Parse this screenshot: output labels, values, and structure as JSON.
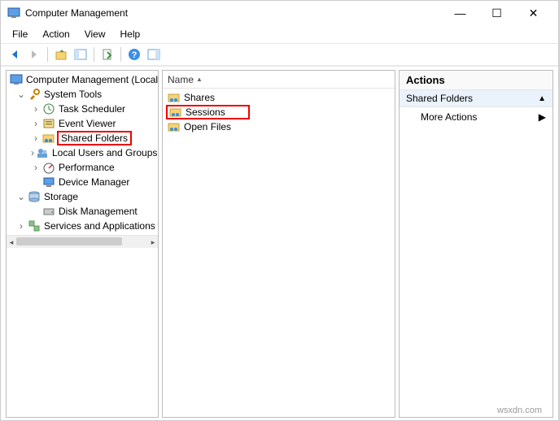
{
  "window": {
    "title": "Computer Management",
    "controls": {
      "min": "—",
      "max": "☐",
      "close": "✕"
    }
  },
  "menubar": {
    "file": "File",
    "action": "Action",
    "view": "View",
    "help": "Help"
  },
  "tree": {
    "root": "Computer Management (Local)",
    "system_tools": "System Tools",
    "task_scheduler": "Task Scheduler",
    "event_viewer": "Event Viewer",
    "shared_folders": "Shared Folders",
    "local_users": "Local Users and Groups",
    "performance": "Performance",
    "device_manager": "Device Manager",
    "storage": "Storage",
    "disk_management": "Disk Management",
    "services_apps": "Services and Applications"
  },
  "list": {
    "col_name": "Name",
    "items": {
      "shares": "Shares",
      "sessions": "Sessions",
      "open_files": "Open Files"
    }
  },
  "actions": {
    "header": "Actions",
    "section": "Shared Folders",
    "more": "More Actions"
  },
  "watermark": "wsxdn.com"
}
